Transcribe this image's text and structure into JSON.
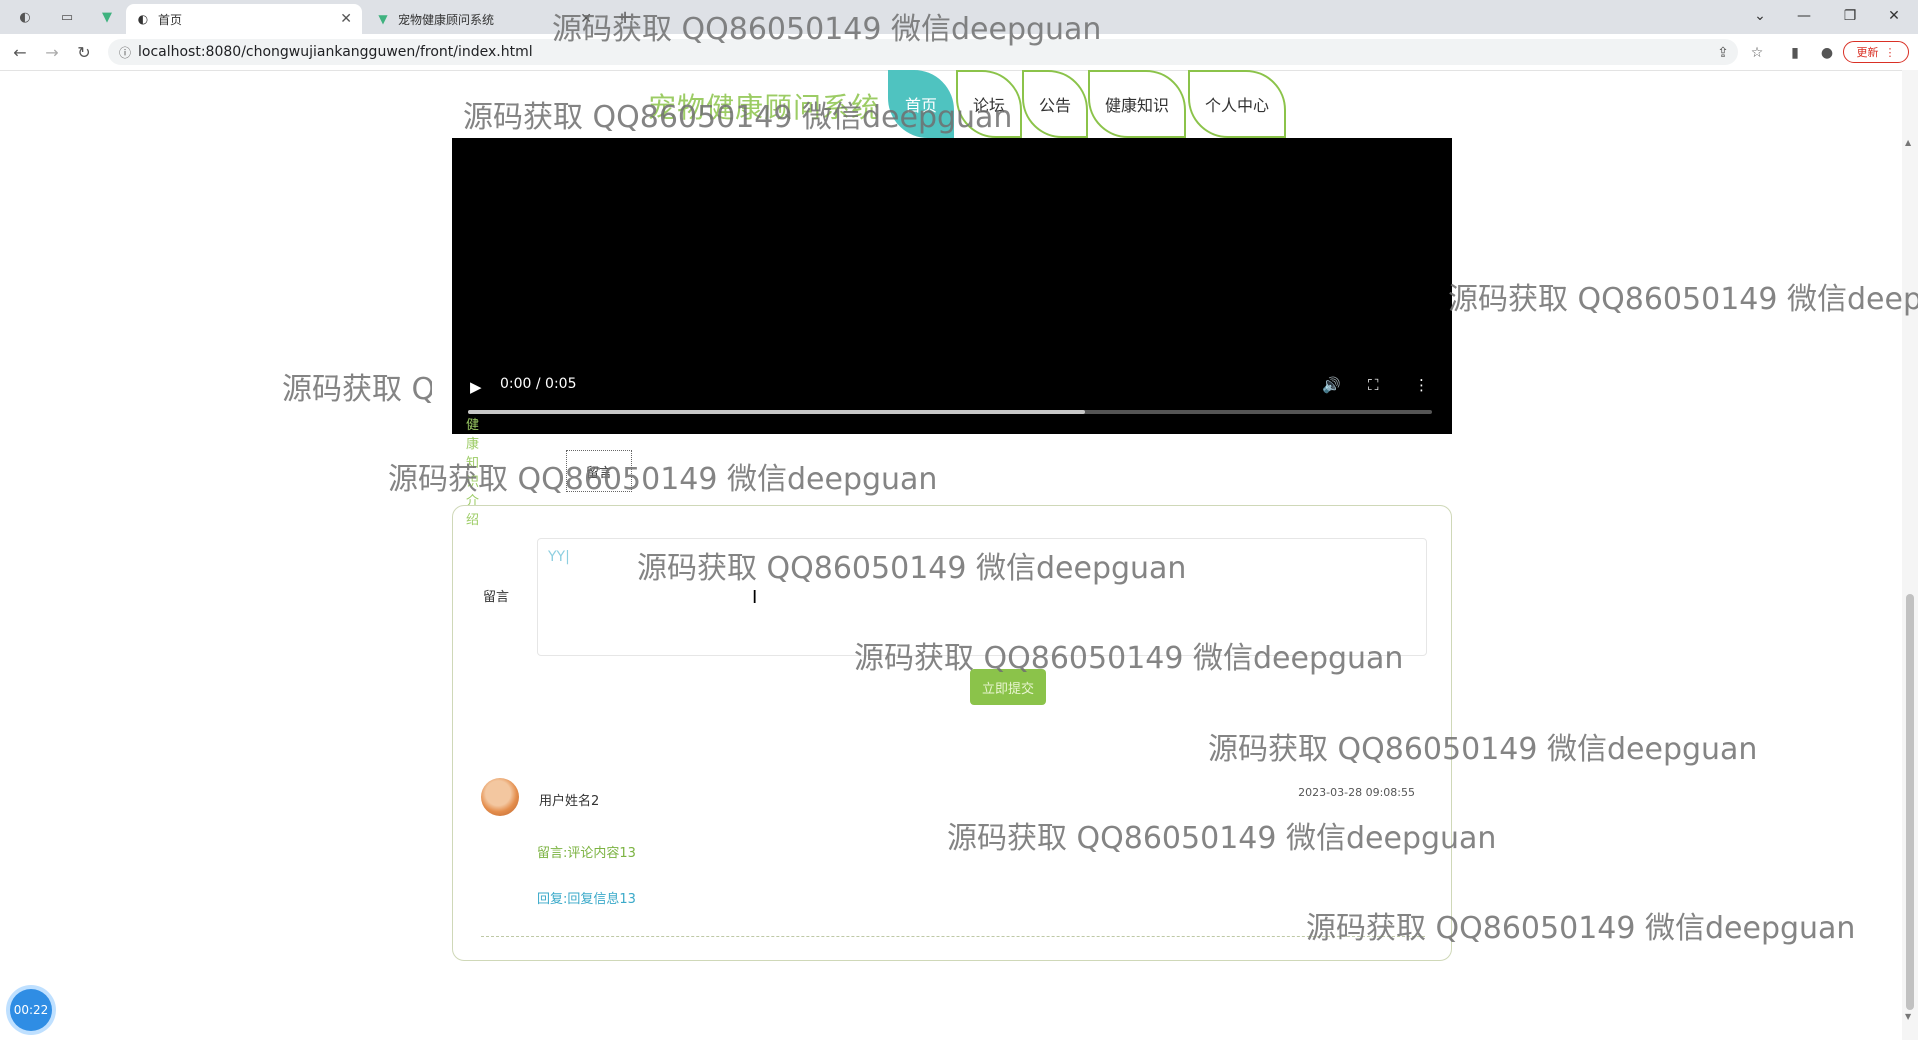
{
  "browser": {
    "tabs": [
      {
        "label": "首页",
        "active": true
      },
      {
        "label": "宠物健康顾问系统",
        "active": false
      }
    ],
    "new_tab": "+",
    "url": "localhost:8080/chongwujiankangguwen/front/index.html",
    "update_label": "更新"
  },
  "site": {
    "title": "宠物健康顾问系统",
    "nav": [
      "首页",
      "论坛",
      "公告",
      "健康知识",
      "个人中心"
    ]
  },
  "video": {
    "time": "0:00 / 0:05",
    "progress": 0.64
  },
  "tabs": {
    "intro": "健康知识介绍",
    "message": "留言"
  },
  "message_form": {
    "label": "留言",
    "value": "YY|",
    "submit": "立即提交"
  },
  "comment": {
    "user": "用户姓名2",
    "time": "2023-03-28 09:08:55",
    "content": "留言:评论内容13",
    "reply": "回复:回复信息13"
  },
  "recorder": {
    "time": "00:22"
  },
  "watermark": "源码获取 QQ86050149 微信deepguan"
}
